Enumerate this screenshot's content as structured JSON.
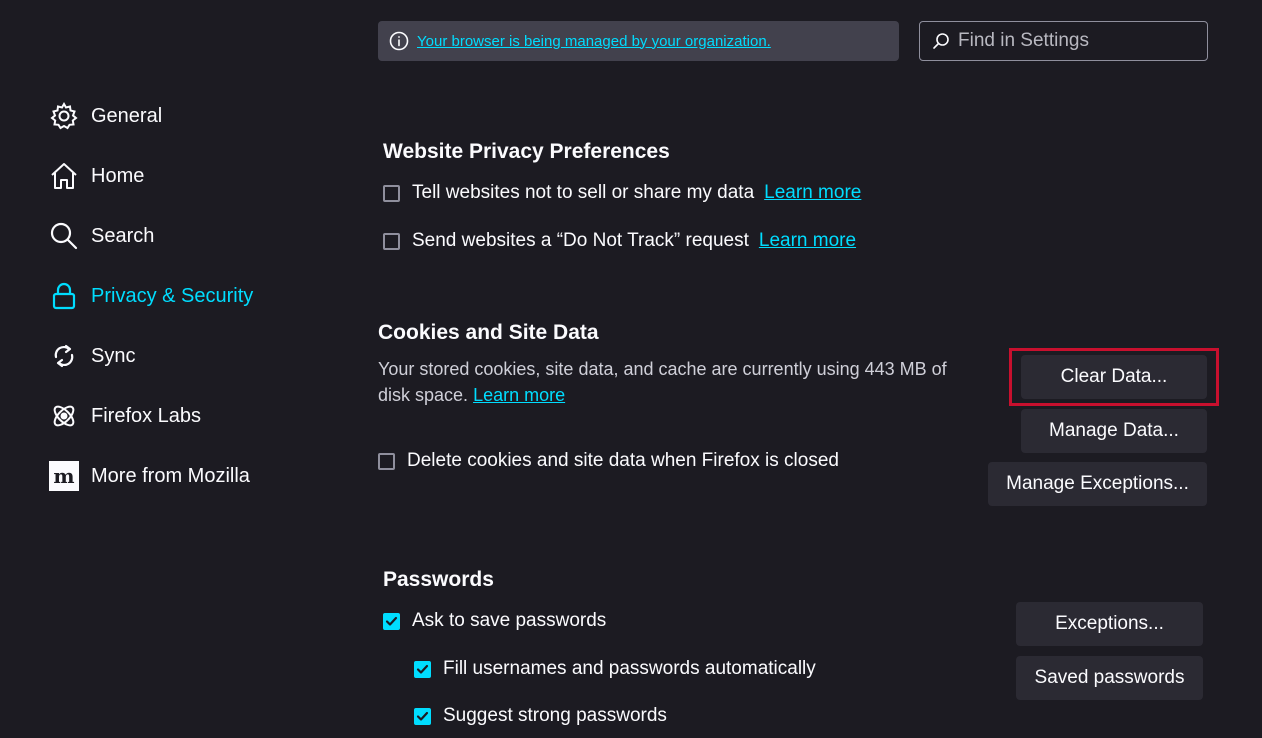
{
  "sidebar": {
    "items": [
      {
        "label": "General",
        "icon": "gear-icon"
      },
      {
        "label": "Home",
        "icon": "home-icon"
      },
      {
        "label": "Search",
        "icon": "search-icon"
      },
      {
        "label": "Privacy & Security",
        "icon": "lock-icon",
        "selected": true
      },
      {
        "label": "Sync",
        "icon": "sync-icon"
      },
      {
        "label": "Firefox Labs",
        "icon": "labs-icon"
      },
      {
        "label": "More from Mozilla",
        "icon": "mozilla-logo-icon"
      }
    ]
  },
  "header": {
    "policy_link": "Your browser is being managed by your organization.",
    "search_placeholder": "Find in Settings"
  },
  "privacy_prefs": {
    "title": "Website Privacy Preferences",
    "sell_share_label": "Tell websites not to sell or share my data",
    "sell_share_checked": false,
    "dnt_label": "Send websites a “Do Not Track” request",
    "dnt_checked": false,
    "learn_more": "Learn more"
  },
  "cookies": {
    "title": "Cookies and Site Data",
    "description": "Your stored cookies, site data, and cache are currently using 443 MB of disk space.",
    "learn_more": "Learn more",
    "delete_on_close_label": "Delete cookies and site data when Firefox is closed",
    "delete_on_close_checked": false,
    "clear_data_button": "Clear Data...",
    "manage_data_button": "Manage Data...",
    "manage_exceptions_button": "Manage Exceptions..."
  },
  "passwords": {
    "title": "Passwords",
    "ask_to_save_label": "Ask to save passwords",
    "ask_to_save_checked": true,
    "autofill_label": "Fill usernames and passwords automatically",
    "autofill_checked": true,
    "suggest_strong_label": "Suggest strong passwords",
    "suggest_strong_checked": true,
    "exceptions_button": "Exceptions...",
    "saved_passwords_button": "Saved passwords"
  },
  "colors": {
    "background": "#1c1b22",
    "accent": "#00ddff",
    "button": "#2b2a33",
    "highlight": "#c8102e"
  }
}
